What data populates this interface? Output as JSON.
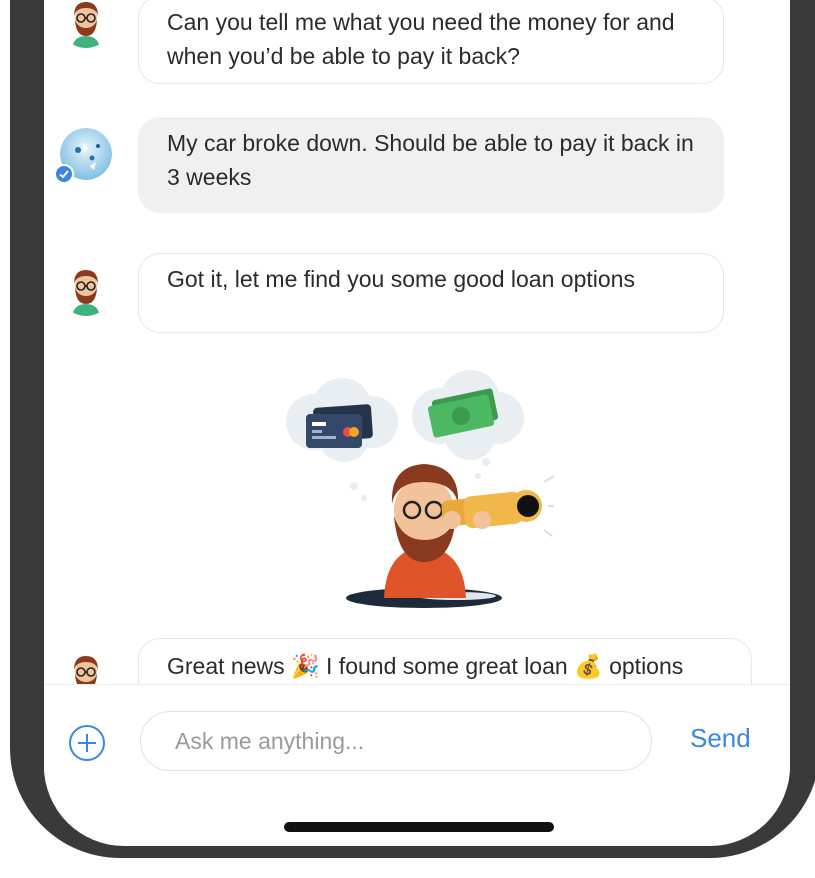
{
  "messages": [
    {
      "sender": "bot",
      "text": "Can you tell me what you need the money for and when you’d be able to pay it back?"
    },
    {
      "sender": "user",
      "text": "My car broke down. Should be able to pay it back in 3 weeks"
    },
    {
      "sender": "bot",
      "text": "Got it, let me find you some good loan options"
    },
    {
      "sender": "bot",
      "text": "Great news 🎉 I found some great loan 💰 options"
    }
  ],
  "composer": {
    "placeholder": "Ask me anything...",
    "send_label": "Send"
  },
  "colors": {
    "accent": "#3b87e0",
    "user_bubble": "#f0f0f0",
    "frame": "#3a3a3a"
  },
  "icons": {
    "add": "plus-circle-icon",
    "bot_avatar": "bearded-man-avatar",
    "user_avatar": "user-avatar",
    "verified": "verified-check-icon"
  }
}
